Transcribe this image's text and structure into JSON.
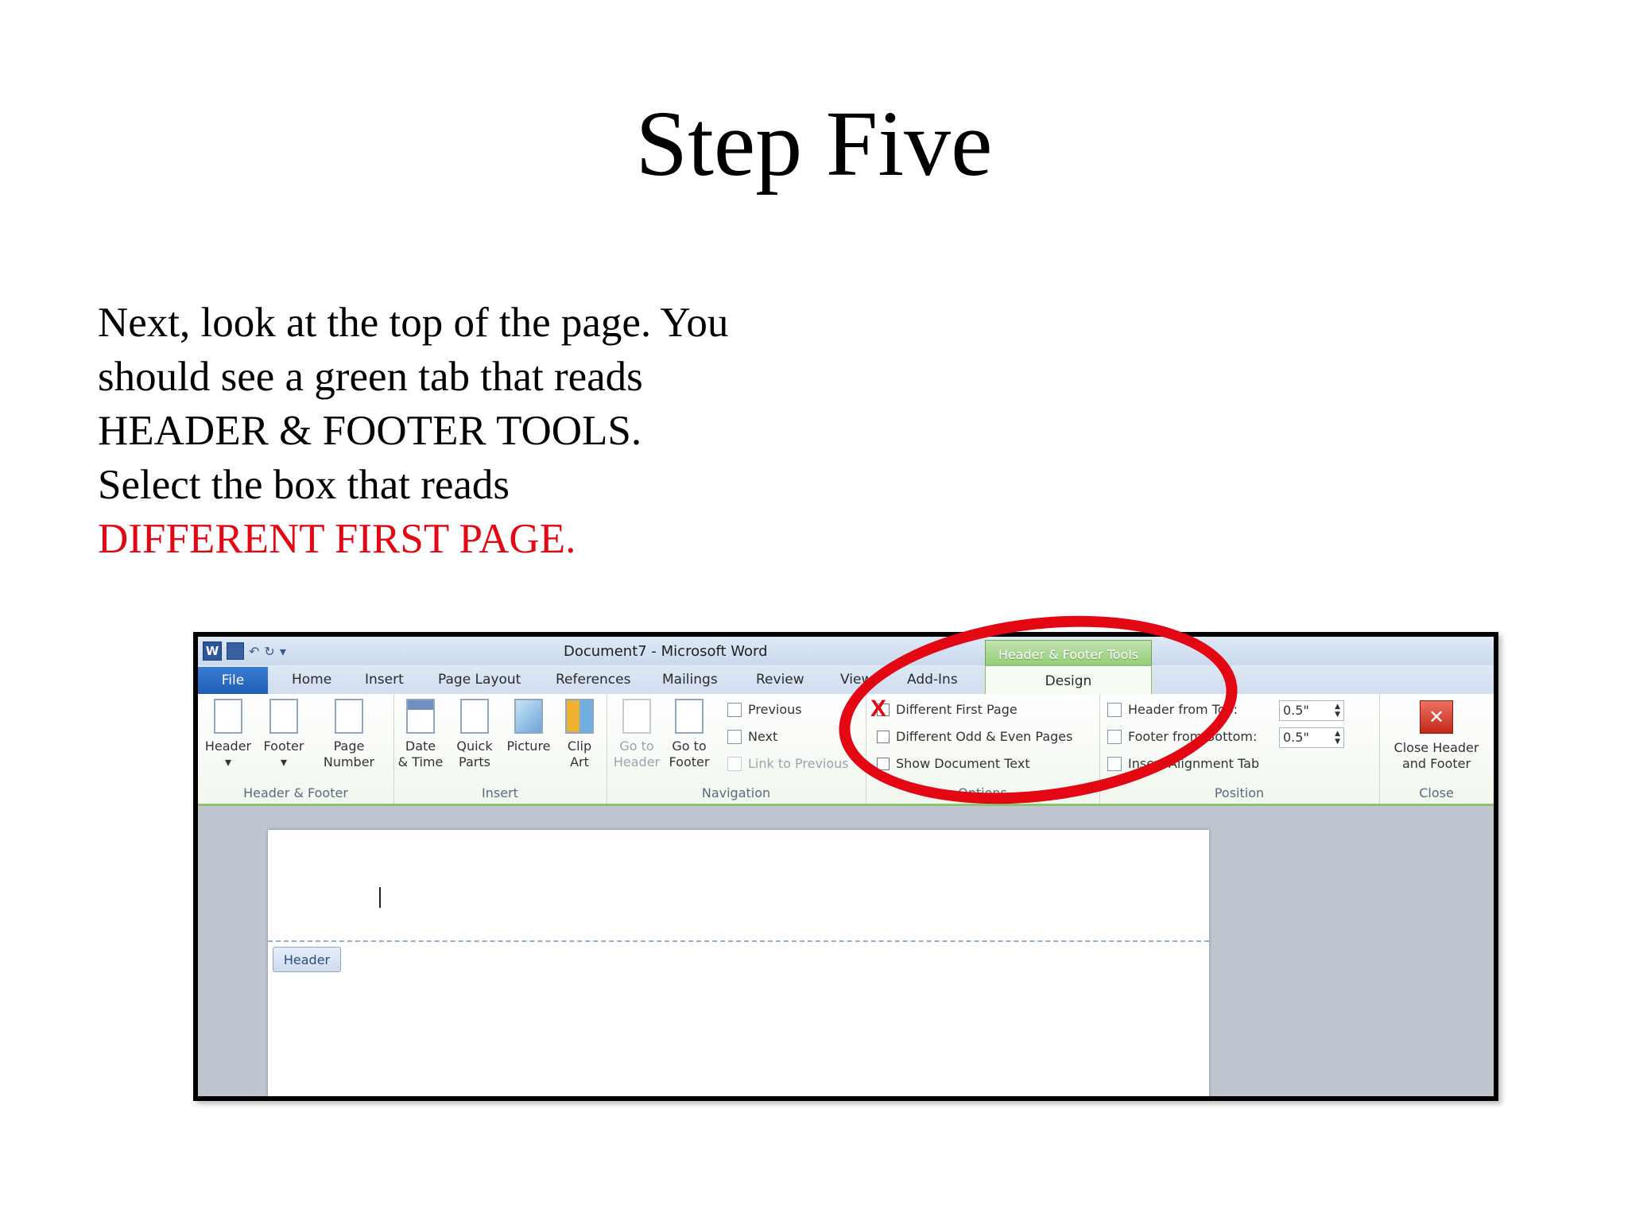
{
  "slide": {
    "title": "Step Five",
    "body_lines": [
      "Next, look at the top of the page. You",
      "should see a green tab that reads",
      "HEADER & FOOTER TOOLS.",
      "Select the box that reads"
    ],
    "highlight_line": "DIFFERENT FIRST PAGE.",
    "highlight_color": "#e30613"
  },
  "window": {
    "title": "Document7  -  Microsoft Word",
    "context_tab": "Header & Footer Tools",
    "context_color": "#8ecb6e"
  },
  "tabs": {
    "file": "File",
    "home": "Home",
    "insert": "Insert",
    "page_layout": "Page Layout",
    "references": "References",
    "mailings": "Mailings",
    "review": "Review",
    "view": "View",
    "addins": "Add-Ins",
    "design": "Design"
  },
  "ribbon": {
    "header_footer": {
      "label": "Header & Footer",
      "header": "Header",
      "footer": "Footer",
      "page_number_1": "Page",
      "page_number_2": "Number"
    },
    "insert": {
      "label": "Insert",
      "date_1": "Date",
      "date_2": "& Time",
      "quick_1": "Quick",
      "quick_2": "Parts",
      "picture": "Picture",
      "clip_1": "Clip",
      "clip_2": "Art"
    },
    "navigation": {
      "label": "Navigation",
      "goto_header_1": "Go to",
      "goto_header_2": "Header",
      "goto_footer_1": "Go to",
      "goto_footer_2": "Footer",
      "previous": "Previous",
      "next": "Next",
      "link_previous": "Link to Previous"
    },
    "options": {
      "label": "Options",
      "different_first": "Different First Page",
      "different_odd_even": "Different Odd & Even Pages",
      "show_doc_text": "Show Document Text",
      "marked": "X"
    },
    "position": {
      "label": "Position",
      "header_from_top": "Header from Top:",
      "footer_from_bottom": "Footer from Bottom:",
      "insert_alignment": "Insert Alignment Tab",
      "header_value": "0.5\"",
      "footer_value": "0.5\""
    },
    "close": {
      "label": "Close",
      "btn_1": "Close Header",
      "btn_2": "and Footer"
    }
  },
  "document": {
    "header_tag": "Header"
  }
}
